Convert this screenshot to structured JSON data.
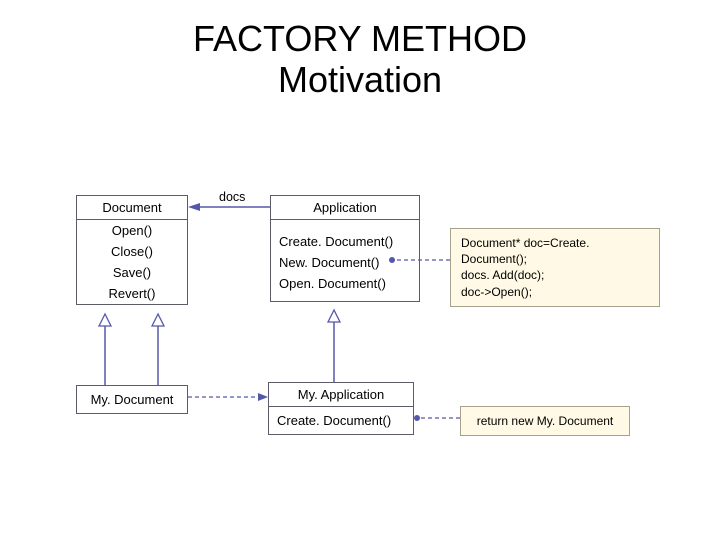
{
  "title_line1": "FACTORY METHOD",
  "title_line2": "Motivation",
  "docs_label": "docs",
  "document": {
    "name": "Document",
    "ops": [
      "Open()",
      "Close()",
      "Save()",
      "Revert()"
    ]
  },
  "application": {
    "name": "Application",
    "ops": [
      "Create. Document()",
      "New. Document()",
      "Open. Document()"
    ]
  },
  "mydocument": {
    "name": "My. Document"
  },
  "myapplication": {
    "name": "My. Application",
    "op": "Create. Document()"
  },
  "note1": {
    "line1": "Document* doc=Create. Document();",
    "line2": "docs. Add(doc);",
    "line3": "doc->Open();"
  },
  "note2": "return new My. Document"
}
